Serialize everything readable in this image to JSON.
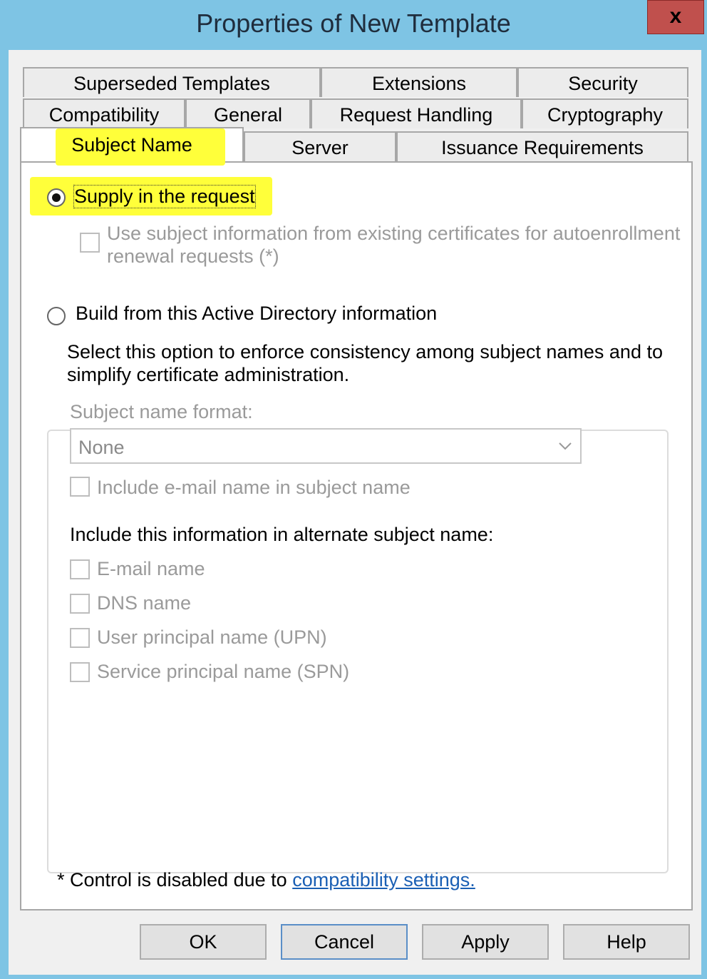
{
  "window": {
    "title": "Properties of New Template",
    "close_glyph": "x"
  },
  "tabs": {
    "row1": [
      "Superseded Templates",
      "Extensions",
      "Security"
    ],
    "row2": [
      "Compatibility",
      "General",
      "Request Handling",
      "Cryptography"
    ],
    "row3": [
      "Subject Name",
      "Server",
      "Issuance Requirements"
    ],
    "active": "Subject Name"
  },
  "subject": {
    "supply_label": "Supply in the request",
    "supply_selected": true,
    "use_existing_line1": "Use subject information from existing certificates for autoenrollment",
    "use_existing_line2": "renewal requests (*)",
    "build_label": "Build from this Active Directory information",
    "build_selected": false,
    "description_line1": "Select this option to enforce consistency among subject names and to",
    "description_line2": "simplify certificate administration.",
    "format_label": "Subject name format:",
    "format_value": "None",
    "include_email": "Include e-mail name in subject name",
    "alt_heading": "Include this information in alternate subject name:",
    "alt_options": [
      "E-mail name",
      "DNS name",
      "User principal name (UPN)",
      "Service principal name (SPN)"
    ]
  },
  "footer": {
    "note_prefix": "* Control is disabled due to ",
    "note_link": "compatibility settings."
  },
  "buttons": {
    "ok": "OK",
    "cancel": "Cancel",
    "apply": "Apply",
    "help": "Help"
  },
  "colors": {
    "title_bar": "#7ec4e4",
    "close": "#c0504d",
    "highlight": "#ffff3a",
    "link": "#1a5fb4"
  }
}
